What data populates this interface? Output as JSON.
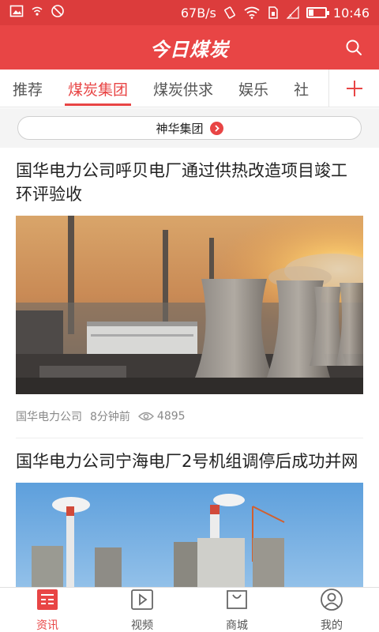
{
  "status_bar": {
    "network_speed": "67B/s",
    "time": "10:46",
    "battery_level": 0.3
  },
  "header": {
    "title": "今日煤炭",
    "search_icon": "search-icon"
  },
  "tabs": [
    {
      "label": "推荐",
      "active": false
    },
    {
      "label": "煤炭集团",
      "active": true
    },
    {
      "label": "煤炭供求",
      "active": false
    },
    {
      "label": "娱乐",
      "active": false
    },
    {
      "label": "社",
      "active": false
    }
  ],
  "subfilter": {
    "label": "神华集团",
    "arrow_icon": "chevron-right-icon"
  },
  "articles": [
    {
      "title": "国华电力公司呼贝电厂通过供热改造项目竣工环评验收",
      "source": "国华电力公司",
      "time": "8分钟前",
      "views": "4895"
    },
    {
      "title": "国华电力公司宁海电厂2号机组调停后成功并网"
    }
  ],
  "bottom_nav": [
    {
      "label": "资讯",
      "icon": "news-icon",
      "active": true
    },
    {
      "label": "视频",
      "icon": "video-play-icon",
      "active": false
    },
    {
      "label": "商城",
      "icon": "shopping-bag-icon",
      "active": false
    },
    {
      "label": "我的",
      "icon": "profile-icon",
      "active": false
    }
  ],
  "colors": {
    "brand_red": "#e84545",
    "status_red": "#dc3c3c"
  }
}
